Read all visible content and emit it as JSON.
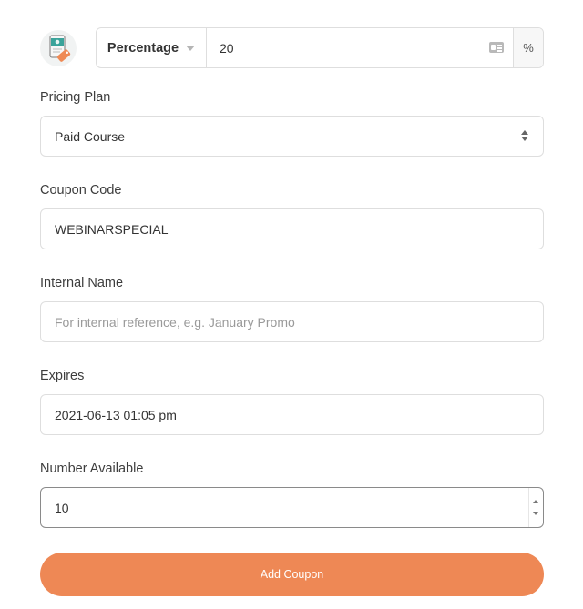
{
  "discount": {
    "type_label": "Percentage",
    "amount_value": "20",
    "unit_addon": "%",
    "icons": {
      "coupon": "coupon-tag-icon",
      "card": "id-card-icon",
      "caret": "caret-down-icon"
    }
  },
  "fields": {
    "pricing_plan": {
      "label": "Pricing Plan",
      "value": "Paid Course"
    },
    "coupon_code": {
      "label": "Coupon Code",
      "value": "WEBINARSPECIAL"
    },
    "internal_name": {
      "label": "Internal Name",
      "value": "",
      "placeholder": "For internal reference, e.g. January Promo"
    },
    "expires": {
      "label": "Expires",
      "value": "2021-06-13 01:05 pm"
    },
    "number_available": {
      "label": "Number Available",
      "value": "10"
    }
  },
  "actions": {
    "submit_label": "Add Coupon"
  },
  "colors": {
    "accent": "#ee8855",
    "border": "#dedede",
    "icon_teal": "#3aa39a"
  }
}
